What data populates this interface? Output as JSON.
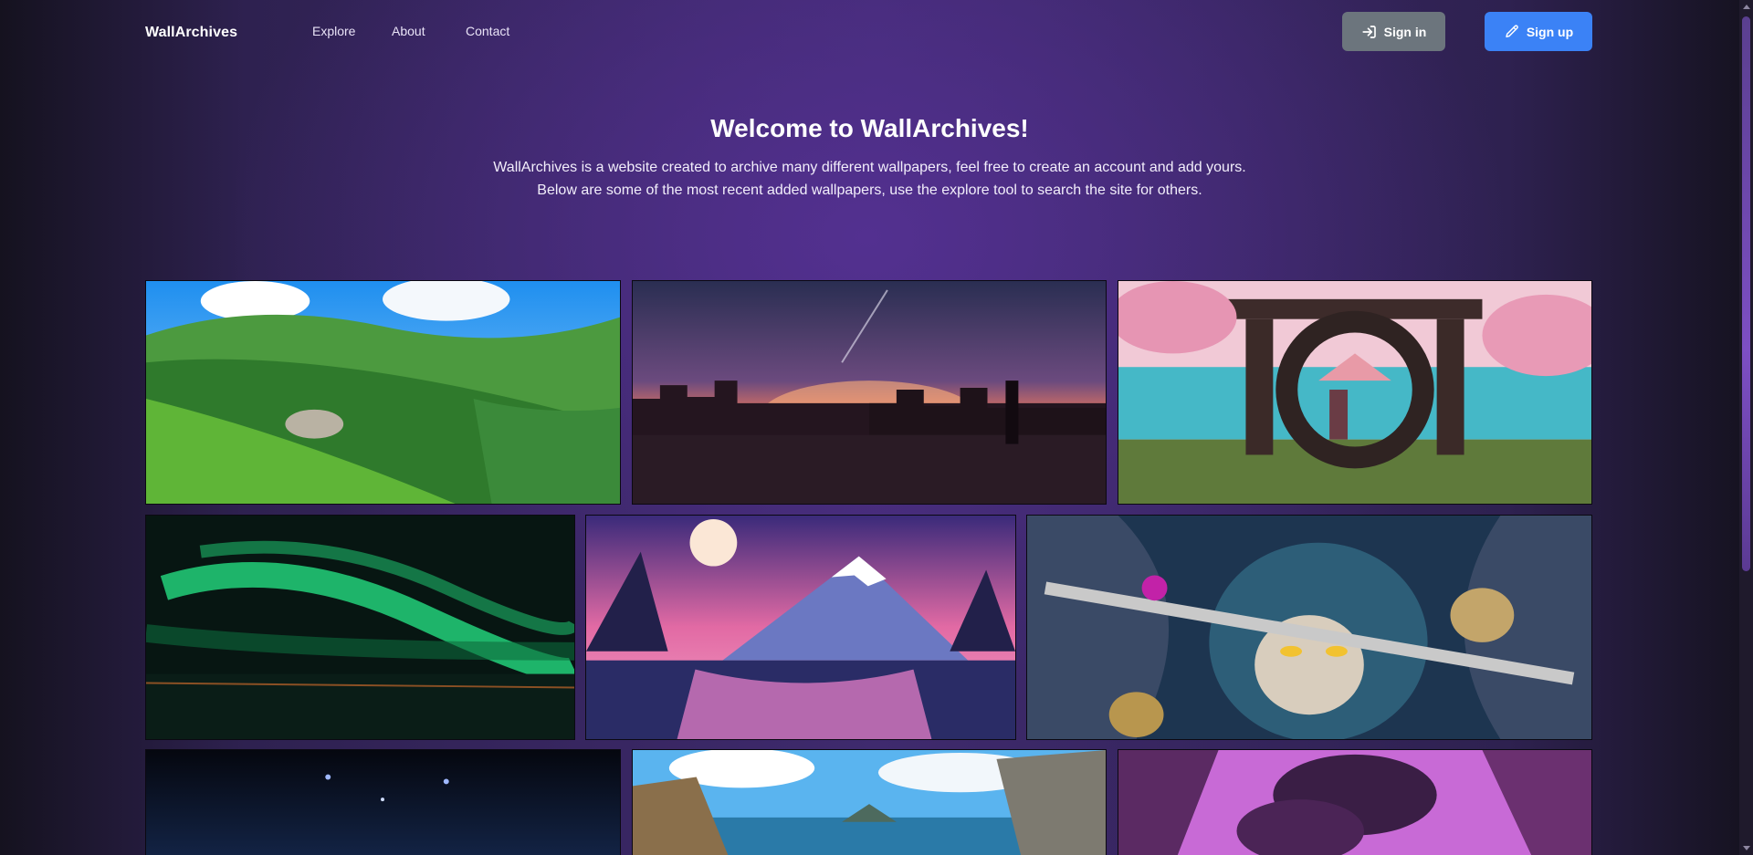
{
  "header": {
    "brand": "WallArchives",
    "nav": [
      "Explore",
      "About",
      "Contact"
    ],
    "signin_label": "Sign in",
    "signup_label": "Sign up"
  },
  "hero": {
    "title": "Welcome to WallArchives!",
    "line1": "WallArchives is a website created to archive many different wallpapers, feel free to create an account and add yours.",
    "line2": "Below are some of the most recent added wallpapers, use the explore tool to search the site for others."
  },
  "colors": {
    "signin_button": "#6c757d",
    "signup_button": "#3b82f6",
    "background_purple": "#3f2a6e"
  },
  "icons": {
    "signin": "login-arrow-icon",
    "signup": "pencil-icon"
  }
}
